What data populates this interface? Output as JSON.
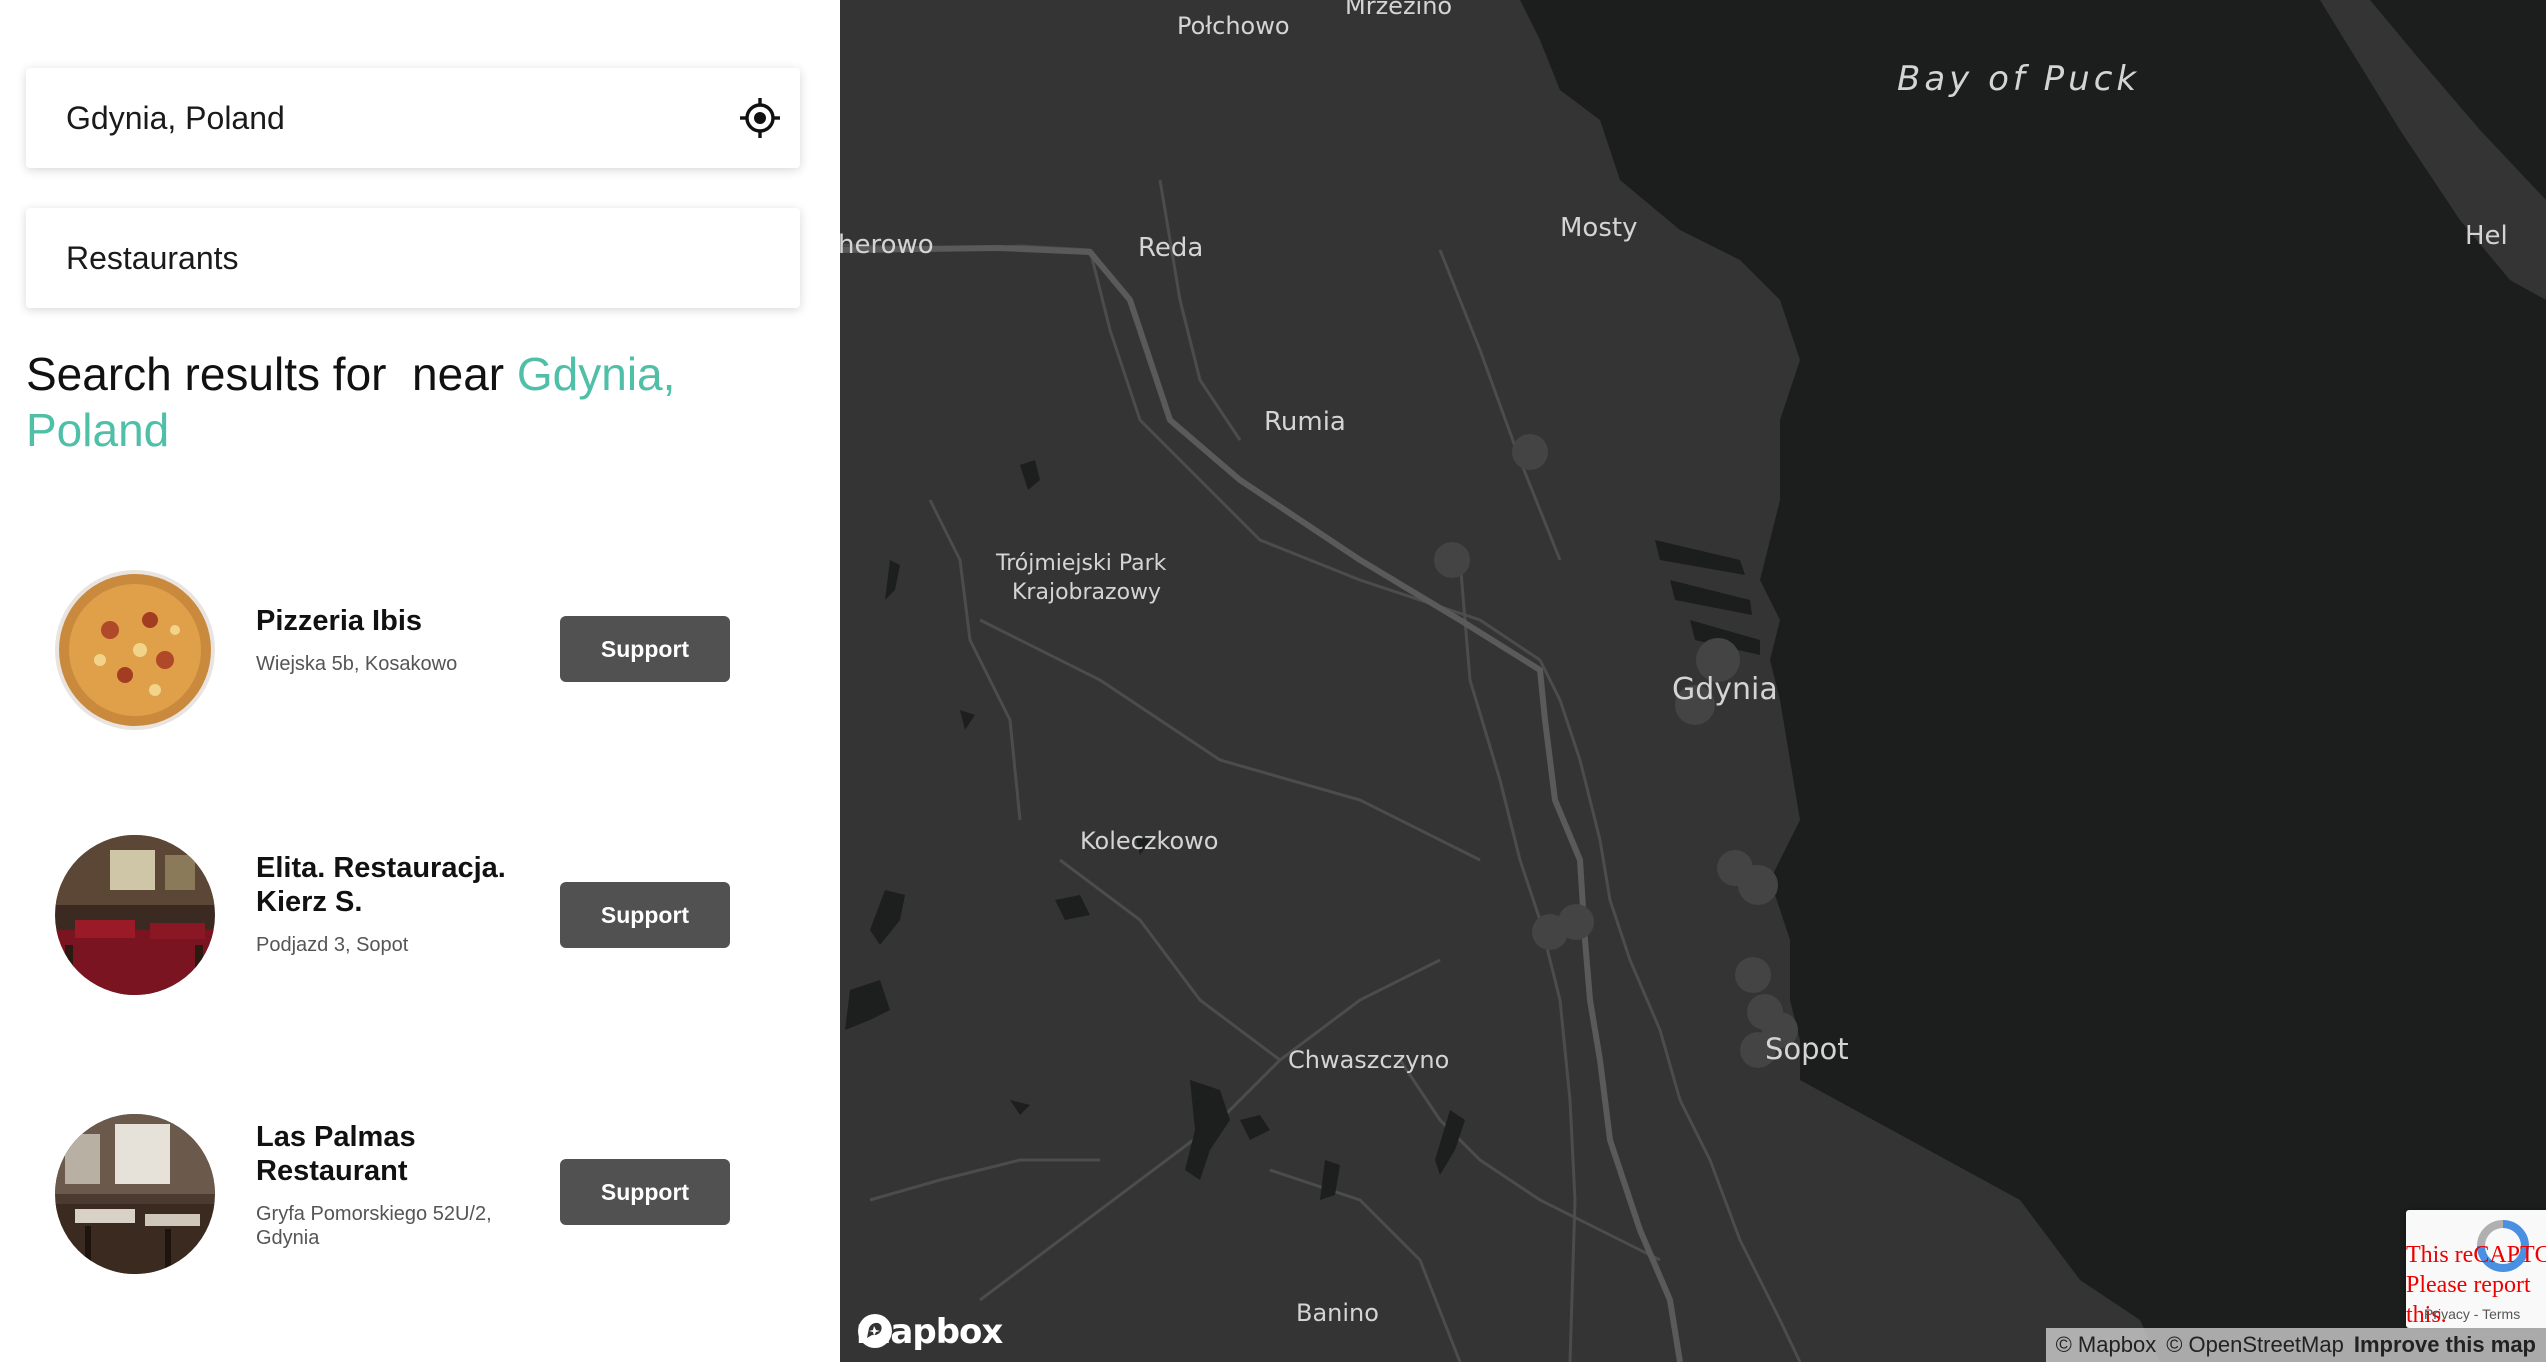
{
  "search": {
    "location_value": "Gdynia, Poland",
    "category_value": "Restaurants"
  },
  "results_heading": {
    "prefix": "Search results for  near ",
    "location": "Gdynia, Poland"
  },
  "results": [
    {
      "name": "Pizzeria Ibis",
      "address": "Wiejska 5b, Kosakowo",
      "button": "Support"
    },
    {
      "name": "Elita. Restauracja. Kierz S.",
      "address": "Podjazd 3, Sopot",
      "button": "Support"
    },
    {
      "name": "Las Palmas Restaurant",
      "address": "Gryfa Pomorskiego 52U/2, Gdynia",
      "button": "Support"
    }
  ],
  "map": {
    "labels": {
      "polchowo": "Połchowo",
      "mrzezino": "Mrzezino",
      "bay": "Bay of Puck",
      "wejherowo": "herowo",
      "reda": "Reda",
      "mosty": "Mosty",
      "hel": "Hel",
      "rumia": "Rumia",
      "park_line1": "Trójmiejski Park",
      "park_line2": "Krajobrazowy",
      "gdynia": "Gdynia",
      "koleczkowo": "Koleczkowo",
      "chwaszczyno": "Chwaszczyno",
      "sopot": "Sopot",
      "banino": "Banino"
    },
    "logo": "mapbox",
    "attribution": {
      "mapbox": "© Mapbox",
      "osm": "© OpenStreetMap",
      "improve": "Improve this map"
    },
    "colors": {
      "land": "#343434",
      "water": "#1c1d1d",
      "accent": "#4fbfa8"
    }
  },
  "recaptcha": {
    "line1": "This reCAPTCHA",
    "line2": "Please report",
    "line3": "this.",
    "footer": "Privacy - Terms"
  }
}
